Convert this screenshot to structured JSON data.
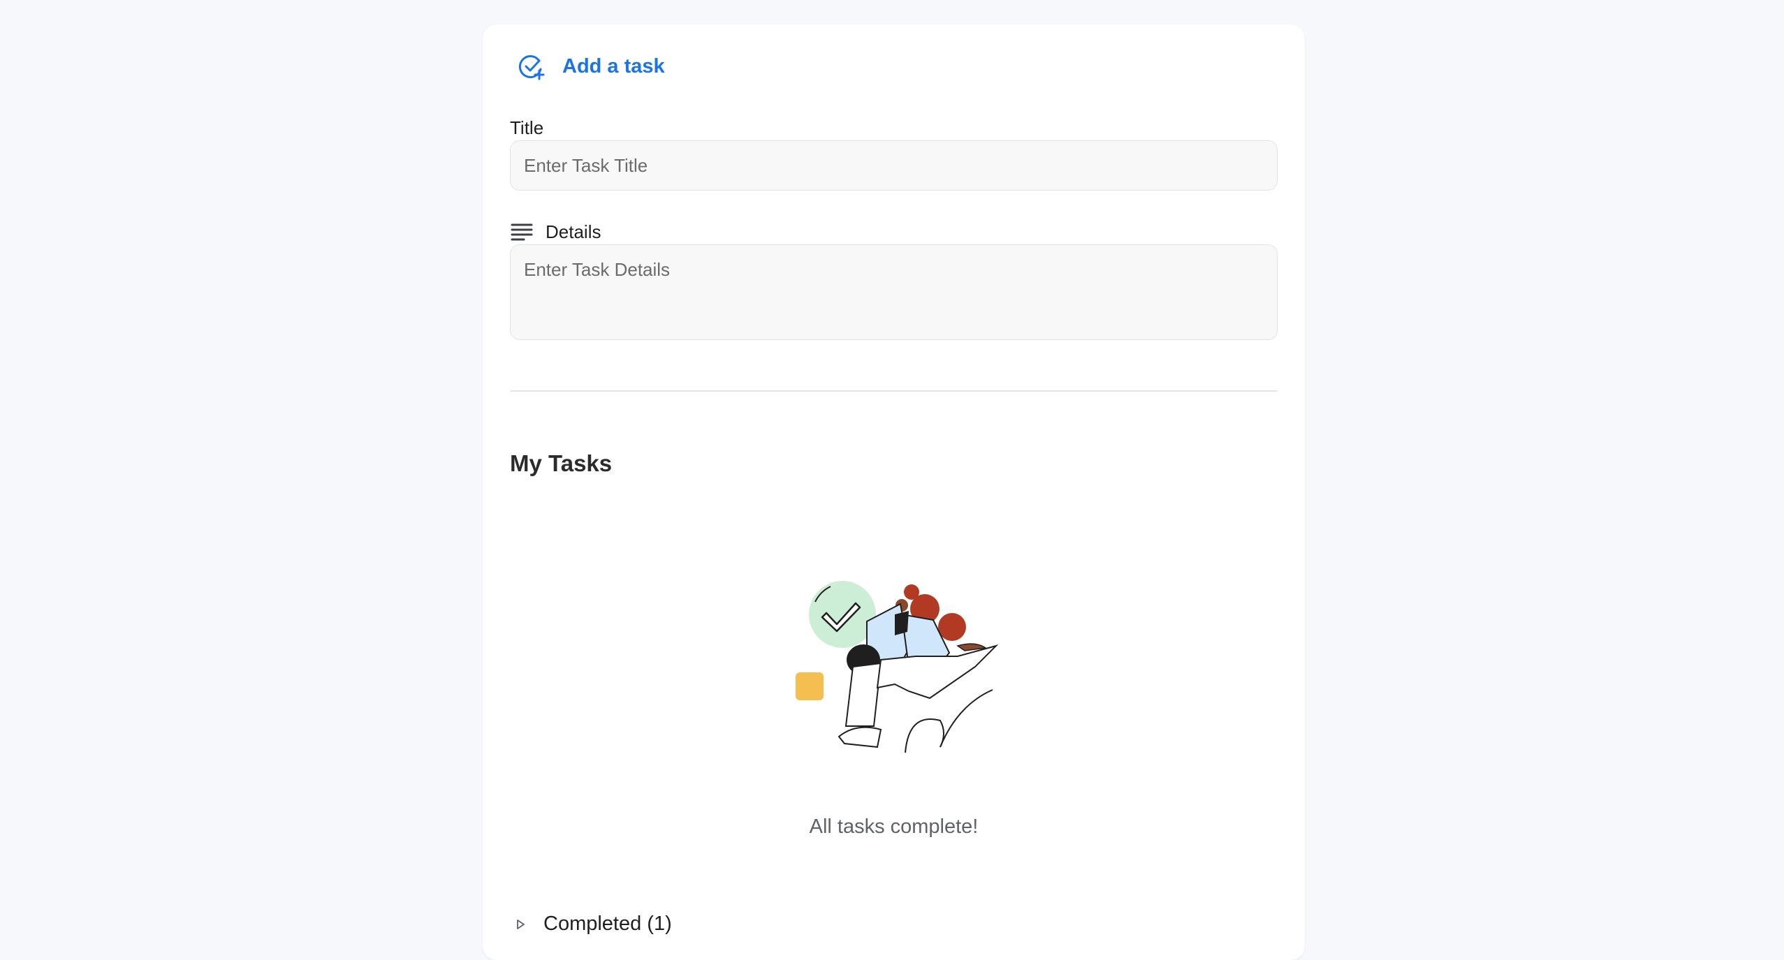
{
  "add_task": {
    "icon": "add-task-icon",
    "label": "Add a task",
    "color": "#1a73e8"
  },
  "form": {
    "title_label": "Title",
    "title_placeholder": "Enter Task Title",
    "details_icon": "notes-lines-icon",
    "details_label": "Details",
    "details_placeholder": "Enter Task Details"
  },
  "tasks": {
    "heading": "My Tasks",
    "empty_illustration": "tasks-complete-illustration",
    "empty_message": "All tasks complete!"
  },
  "completed": {
    "icon": "expand-triangle-icon",
    "label": "Completed (1)"
  },
  "colors": {
    "background": "#f7f8fc",
    "card": "#ffffff",
    "accent": "#1a73e8"
  }
}
